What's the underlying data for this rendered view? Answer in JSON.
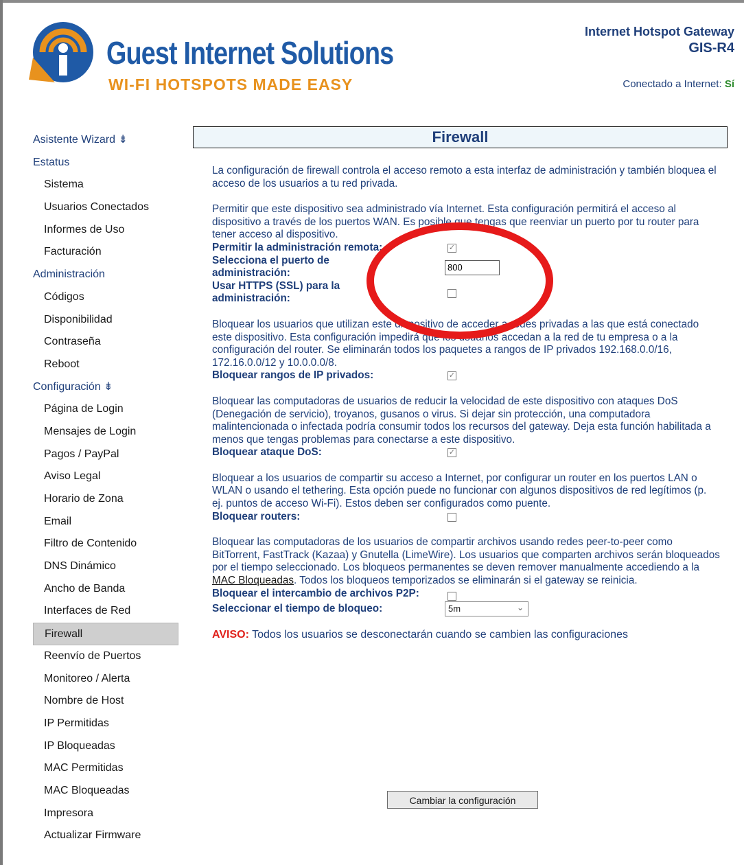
{
  "header": {
    "brand_name": "Guest Internet Solutions",
    "brand_tagline": "WI-FI HOTSPOTS MADE EASY",
    "product_line1": "Internet Hotspot Gateway",
    "product_line2": "GIS-R4",
    "connection_label": "Conectado a Internet:",
    "connection_value": "Sí",
    "colors": {
      "brand_blue": "#1f5aa6",
      "tagline_orange": "#e8921e",
      "status_green": "#2e8b2e"
    }
  },
  "sidebar": {
    "wizard": "Asistente Wizard ⇟",
    "estatus": "Estatus",
    "sistema": "Sistema",
    "usuarios_conectados": "Usuarios Conectados",
    "informes_uso": "Informes de Uso",
    "facturacion": "Facturación",
    "administracion": "Administración",
    "codigos": "Códigos",
    "disponibilidad": "Disponibilidad",
    "contrasena": "Contraseña",
    "reboot": "Reboot",
    "configuracion": "Configuración ⇟",
    "pagina_login": "Página de Login",
    "mensajes_login": "Mensajes de Login",
    "pagos": "Pagos / PayPal",
    "aviso_legal": "Aviso Legal",
    "horario_zona": "Horario de Zona",
    "email": "Email",
    "filtro_contenido": "Filtro de Contenido",
    "dns_dinamico": "DNS Dinámico",
    "ancho_banda": "Ancho de Banda",
    "interfaces_red": "Interfaces de Red",
    "firewall": "Firewall",
    "reenvio_puertos": "Reenvío de Puertos",
    "monitoreo": "Monitoreo / Alerta",
    "nombre_host": "Nombre de Host",
    "ip_permitidas": "IP Permitidas",
    "ip_bloqueadas": "IP Bloqueadas",
    "mac_permitidas": "MAC Permitidas",
    "mac_bloqueadas": "MAC Bloqueadas",
    "impresora": "Impresora",
    "actualizar_firmware": "Actualizar Firmware"
  },
  "main": {
    "title": "Firewall",
    "intro": "La configuración de firewall controla el acceso remoto a esta interfaz de administración y también bloquea el acceso de los usuarios a tu red privada.",
    "remote_desc": "Permitir que este dispositivo sea administrado vía Internet. Esta configuración permitirá el acceso al dispositivo a través de los puertos WAN. Es posible que tengas que reenviar un puerto por tu router para tener acceso al dispositivo.",
    "remote_label": "Permitir la administración remota:",
    "port_label": "Selecciona el puerto de administración:",
    "port_value": "800",
    "https_label": "Usar HTTPS (SSL) para la administración:",
    "private_desc": "Bloquear los usuarios que utilizan este dispositivo de acceder a redes privadas a las que está conectado este dispositivo. Esta configuración impedirá que los usuarios accedan a la red de tu empresa o a la configuración del router. Se eliminarán todos los paquetes a rangos de IP privados 192.168.0.0/16, 172.16.0.0/12 y 10.0.0.0/8.",
    "private_label": "Bloquear rangos de IP privados:",
    "dos_desc": "Bloquear las computadoras de usuarios de reducir la velocidad de este dispositivo con ataques DoS (Denegación de servicio), troyanos, gusanos o virus. Si dejar sin protección, una computadora malintencionada o infectada podría consumir todos los recursos del gateway. Deja esta función habilitada a menos que tengas problemas para conectarse a este dispositivo.",
    "dos_label": "Bloquear ataque DoS:",
    "routers_desc": "Bloquear a los usuarios de compartir su acceso a Internet, por configurar un router en los puertos LAN o WLAN o usando el tethering. Esta opción puede no funcionar con algunos dispositivos de red legítimos (p. ej. puntos de acceso Wi-Fi). Estos deben ser configurados como puente.",
    "routers_label": "Bloquear routers:",
    "p2p_desc_1": "Bloquear las computadoras de los usuarios de compartir archivos usando redes peer-to-peer como BitTorrent, FastTrack (Kazaa) y Gnutella (LimeWire). Los usuarios que comparten archivos serán bloqueados por el tiempo seleccionado. Los bloqueos permanentes se deven remover manualmente accediendo a la",
    "p2p_link": "MAC Bloqueadas",
    "p2p_desc_2": ". Todos los bloqueos temporizados se eliminarán si el gateway se reinicia.",
    "p2p_label": "Bloquear el intercambio de archivos P2P:",
    "block_time_label": "Seleccionar el tiempo de bloqueo:",
    "block_time_value": "5m",
    "warning_prefix": "AVISO:",
    "warning_text": " Todos los usuarios se desconectarán cuando se cambien las configuraciones",
    "submit_label": "Cambiar la configuración",
    "checkboxes": {
      "remote_admin": true,
      "https": false,
      "private_ranges": true,
      "dos": true,
      "routers": false,
      "p2p": false
    }
  },
  "annotation": {
    "circle_color": "#e61a1a"
  }
}
